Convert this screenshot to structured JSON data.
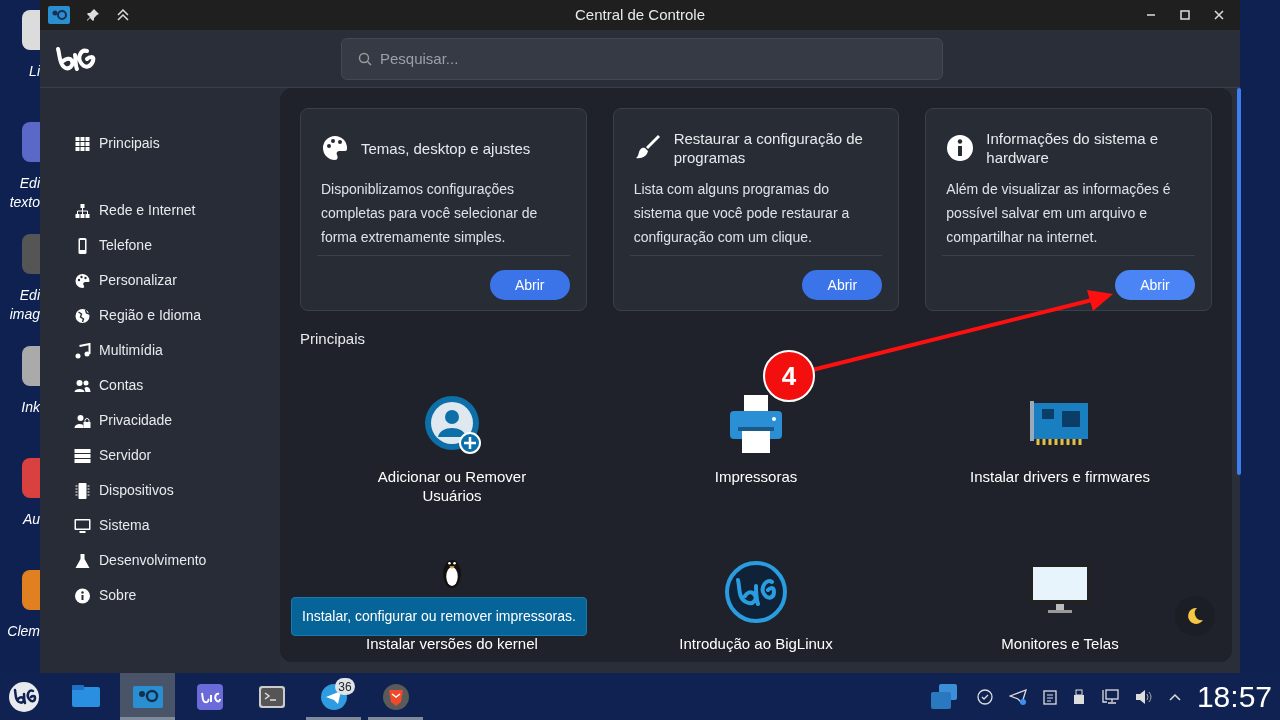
{
  "desktop_icons": [
    {
      "label": "Li"
    },
    {
      "label": "Edi texto"
    },
    {
      "label": "Edi imag"
    },
    {
      "label": "Ink"
    },
    {
      "label": "Au"
    },
    {
      "label": "Clem"
    }
  ],
  "window": {
    "title": "Central de Controle"
  },
  "search": {
    "placeholder": "Pesquisar..."
  },
  "sidebar": {
    "items": [
      {
        "label": "Principais"
      },
      {
        "label": "Rede e Internet"
      },
      {
        "label": "Telefone"
      },
      {
        "label": "Personalizar"
      },
      {
        "label": "Região e Idioma"
      },
      {
        "label": "Multimídia"
      },
      {
        "label": "Contas"
      },
      {
        "label": "Privacidade"
      },
      {
        "label": "Servidor"
      },
      {
        "label": "Dispositivos"
      },
      {
        "label": "Sistema"
      },
      {
        "label": "Desenvolvimento"
      },
      {
        "label": "Sobre"
      }
    ]
  },
  "cards": [
    {
      "title": "Temas, desktop e ajustes",
      "description": "Disponiblizamos configurações completas para você selecionar de forma extremamente simples.",
      "button": "Abrir",
      "hovered": false
    },
    {
      "title": "Restaurar a configuração de programas",
      "description": "Lista com alguns programas do sistema que você pode restaurar a configuração com um clique.",
      "button": "Abrir",
      "hovered": false
    },
    {
      "title": "Informações do sistema e hardware",
      "description": "Além de visualizar as informações é possível salvar em um arquivo e compartilhar na internet.",
      "button": "Abrir",
      "hovered": true
    }
  ],
  "section_title": "Principais",
  "apps": [
    {
      "label": "Adicionar ou Remover Usuários"
    },
    {
      "label": "Impressoras"
    },
    {
      "label": "Instalar drivers e firmwares"
    },
    {
      "label": "Instalar versões do kernel"
    },
    {
      "label": "Introdução ao BigLinux"
    },
    {
      "label": "Monitores e Telas"
    }
  ],
  "tooltip": "Instalar, configurar ou remover impressoras.",
  "annotation": {
    "number": "4"
  },
  "taskbar": {
    "apps": [
      {
        "active": false,
        "running": false
      },
      {
        "active": true,
        "running": true
      },
      {
        "active": false,
        "running": false
      },
      {
        "active": false,
        "running": false
      },
      {
        "active": false,
        "running": true,
        "badge": "36"
      },
      {
        "active": false,
        "running": true
      }
    ],
    "clock": "18:57"
  }
}
